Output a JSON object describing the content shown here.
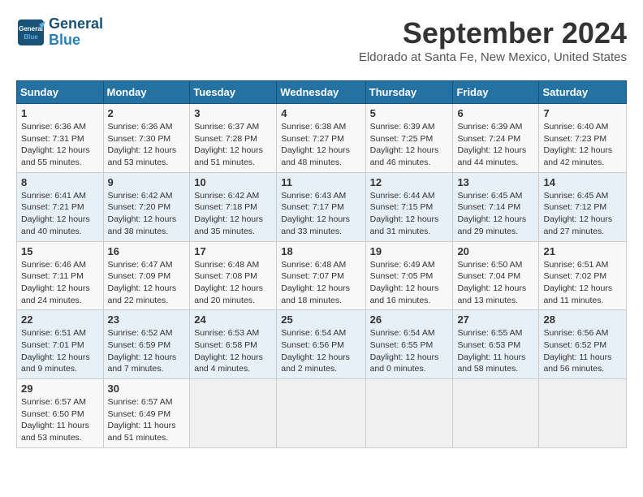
{
  "header": {
    "logo_line1": "General",
    "logo_line2": "Blue",
    "month_title": "September 2024",
    "location": "Eldorado at Santa Fe, New Mexico, United States"
  },
  "columns": [
    "Sunday",
    "Monday",
    "Tuesday",
    "Wednesday",
    "Thursday",
    "Friday",
    "Saturday"
  ],
  "weeks": [
    [
      {
        "day": "1",
        "info": "Sunrise: 6:36 AM\nSunset: 7:31 PM\nDaylight: 12 hours\nand 55 minutes."
      },
      {
        "day": "2",
        "info": "Sunrise: 6:36 AM\nSunset: 7:30 PM\nDaylight: 12 hours\nand 53 minutes."
      },
      {
        "day": "3",
        "info": "Sunrise: 6:37 AM\nSunset: 7:28 PM\nDaylight: 12 hours\nand 51 minutes."
      },
      {
        "day": "4",
        "info": "Sunrise: 6:38 AM\nSunset: 7:27 PM\nDaylight: 12 hours\nand 48 minutes."
      },
      {
        "day": "5",
        "info": "Sunrise: 6:39 AM\nSunset: 7:25 PM\nDaylight: 12 hours\nand 46 minutes."
      },
      {
        "day": "6",
        "info": "Sunrise: 6:39 AM\nSunset: 7:24 PM\nDaylight: 12 hours\nand 44 minutes."
      },
      {
        "day": "7",
        "info": "Sunrise: 6:40 AM\nSunset: 7:23 PM\nDaylight: 12 hours\nand 42 minutes."
      }
    ],
    [
      {
        "day": "8",
        "info": "Sunrise: 6:41 AM\nSunset: 7:21 PM\nDaylight: 12 hours\nand 40 minutes."
      },
      {
        "day": "9",
        "info": "Sunrise: 6:42 AM\nSunset: 7:20 PM\nDaylight: 12 hours\nand 38 minutes."
      },
      {
        "day": "10",
        "info": "Sunrise: 6:42 AM\nSunset: 7:18 PM\nDaylight: 12 hours\nand 35 minutes."
      },
      {
        "day": "11",
        "info": "Sunrise: 6:43 AM\nSunset: 7:17 PM\nDaylight: 12 hours\nand 33 minutes."
      },
      {
        "day": "12",
        "info": "Sunrise: 6:44 AM\nSunset: 7:15 PM\nDaylight: 12 hours\nand 31 minutes."
      },
      {
        "day": "13",
        "info": "Sunrise: 6:45 AM\nSunset: 7:14 PM\nDaylight: 12 hours\nand 29 minutes."
      },
      {
        "day": "14",
        "info": "Sunrise: 6:45 AM\nSunset: 7:12 PM\nDaylight: 12 hours\nand 27 minutes."
      }
    ],
    [
      {
        "day": "15",
        "info": "Sunrise: 6:46 AM\nSunset: 7:11 PM\nDaylight: 12 hours\nand 24 minutes."
      },
      {
        "day": "16",
        "info": "Sunrise: 6:47 AM\nSunset: 7:09 PM\nDaylight: 12 hours\nand 22 minutes."
      },
      {
        "day": "17",
        "info": "Sunrise: 6:48 AM\nSunset: 7:08 PM\nDaylight: 12 hours\nand 20 minutes."
      },
      {
        "day": "18",
        "info": "Sunrise: 6:48 AM\nSunset: 7:07 PM\nDaylight: 12 hours\nand 18 minutes."
      },
      {
        "day": "19",
        "info": "Sunrise: 6:49 AM\nSunset: 7:05 PM\nDaylight: 12 hours\nand 16 minutes."
      },
      {
        "day": "20",
        "info": "Sunrise: 6:50 AM\nSunset: 7:04 PM\nDaylight: 12 hours\nand 13 minutes."
      },
      {
        "day": "21",
        "info": "Sunrise: 6:51 AM\nSunset: 7:02 PM\nDaylight: 12 hours\nand 11 minutes."
      }
    ],
    [
      {
        "day": "22",
        "info": "Sunrise: 6:51 AM\nSunset: 7:01 PM\nDaylight: 12 hours\nand 9 minutes."
      },
      {
        "day": "23",
        "info": "Sunrise: 6:52 AM\nSunset: 6:59 PM\nDaylight: 12 hours\nand 7 minutes."
      },
      {
        "day": "24",
        "info": "Sunrise: 6:53 AM\nSunset: 6:58 PM\nDaylight: 12 hours\nand 4 minutes."
      },
      {
        "day": "25",
        "info": "Sunrise: 6:54 AM\nSunset: 6:56 PM\nDaylight: 12 hours\nand 2 minutes."
      },
      {
        "day": "26",
        "info": "Sunrise: 6:54 AM\nSunset: 6:55 PM\nDaylight: 12 hours\nand 0 minutes."
      },
      {
        "day": "27",
        "info": "Sunrise: 6:55 AM\nSunset: 6:53 PM\nDaylight: 11 hours\nand 58 minutes."
      },
      {
        "day": "28",
        "info": "Sunrise: 6:56 AM\nSunset: 6:52 PM\nDaylight: 11 hours\nand 56 minutes."
      }
    ],
    [
      {
        "day": "29",
        "info": "Sunrise: 6:57 AM\nSunset: 6:50 PM\nDaylight: 11 hours\nand 53 minutes."
      },
      {
        "day": "30",
        "info": "Sunrise: 6:57 AM\nSunset: 6:49 PM\nDaylight: 11 hours\nand 51 minutes."
      },
      {
        "day": "",
        "info": ""
      },
      {
        "day": "",
        "info": ""
      },
      {
        "day": "",
        "info": ""
      },
      {
        "day": "",
        "info": ""
      },
      {
        "day": "",
        "info": ""
      }
    ]
  ]
}
